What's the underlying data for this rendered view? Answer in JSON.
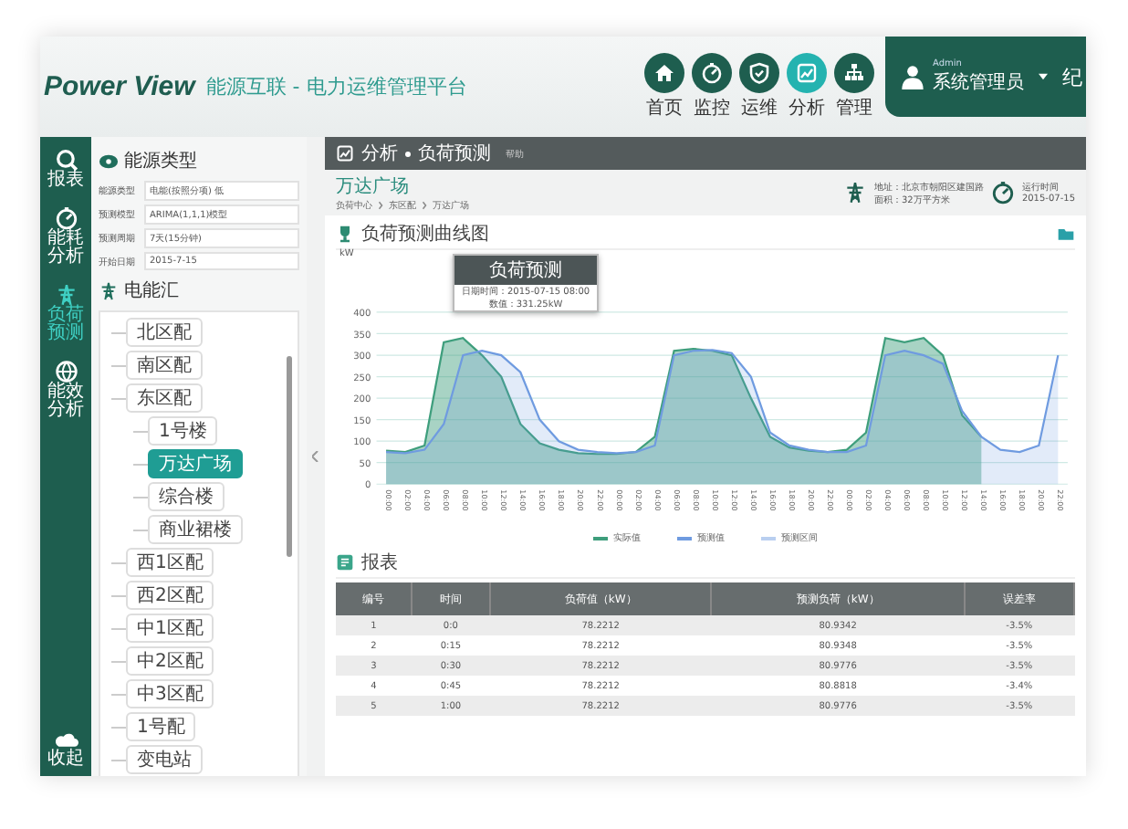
{
  "header": {
    "logo": "Power View",
    "title": "能源互联 - 电力运维管理平台",
    "nav": [
      {
        "label": "首页",
        "selected": false
      },
      {
        "label": "监控",
        "selected": false
      },
      {
        "label": "运维",
        "selected": false
      },
      {
        "label": "分析",
        "selected": true
      },
      {
        "label": "管理",
        "selected": false
      }
    ],
    "user": {
      "role": "Admin",
      "name": "系统管理员",
      "extra": "纪"
    }
  },
  "rail": [
    {
      "label": "报表",
      "selected": false
    },
    {
      "label": "能耗分析",
      "selected": false
    },
    {
      "label": "负荷预测",
      "selected": true
    },
    {
      "label": "能效分析",
      "selected": false
    }
  ],
  "rail_footer": {
    "label": "收起"
  },
  "sidebar": {
    "filter_title": "能源类型",
    "fields": [
      {
        "label": "能源类型",
        "value": "电能(按照分项) 低"
      },
      {
        "label": "预测模型",
        "value": "ARIMA(1,1,1)模型"
      },
      {
        "label": "预测周期",
        "value": "7天(15分钟)"
      },
      {
        "label": "开始日期",
        "value": "2015-7-15"
      }
    ],
    "tree_title": "电能汇",
    "tree": [
      {
        "label": "北区配",
        "selected": false
      },
      {
        "label": "南区配",
        "selected": false
      },
      {
        "label": "东区配",
        "selected": false,
        "children": [
          {
            "label": "1号楼",
            "selected": false
          },
          {
            "label": "万达广场",
            "selected": true
          },
          {
            "label": "综合楼",
            "selected": false
          },
          {
            "label": "商业裙楼",
            "selected": false
          }
        ]
      },
      {
        "label": "西1区配",
        "selected": false
      },
      {
        "label": "西2区配",
        "selected": false
      },
      {
        "label": "中1区配",
        "selected": false
      },
      {
        "label": "中2区配",
        "selected": false
      },
      {
        "label": "中3区配",
        "selected": false
      },
      {
        "label": "1号配",
        "selected": false
      },
      {
        "label": "变电站",
        "selected": false
      }
    ]
  },
  "breadcrumb": {
    "items": [
      "分析",
      "负荷预测"
    ],
    "note": "帮助"
  },
  "site": {
    "name": "万达广场",
    "path": [
      "负荷中心",
      "东区配",
      "万达广场"
    ],
    "info": [
      {
        "label": "地址：",
        "value": "北京市朝阳区建国路"
      },
      {
        "label": "面积：",
        "value": "32万平方米"
      }
    ],
    "clock": {
      "label": "运行时间",
      "value": "2015-07-15"
    }
  },
  "chart_panel": {
    "title": "负荷预测曲线图",
    "unit": "kW",
    "band_label": "预测区间",
    "tooltip": {
      "title": "负荷预测",
      "lines": [
        "日期时间：2015-07-15 08:00",
        "数值：331.25kW"
      ]
    },
    "chart_data": {
      "type": "area",
      "categories": [
        "00:00",
        "02:00",
        "04:00",
        "06:00",
        "08:00",
        "10:00",
        "12:00",
        "14:00",
        "16:00",
        "18:00",
        "20:00",
        "22:00",
        "00:00",
        "02:00",
        "04:00",
        "06:00",
        "08:00",
        "10:00",
        "12:00",
        "14:00",
        "16:00",
        "18:00",
        "20:00",
        "22:00",
        "00:00",
        "02:00",
        "04:00",
        "06:00",
        "08:00",
        "10:00",
        "12:00",
        "14:00",
        "16:00",
        "18:00",
        "20:00",
        "22:00"
      ],
      "series": [
        {
          "name": "实际值",
          "color": "#3e9e7c",
          "values": [
            78,
            75,
            90,
            330,
            340,
            300,
            250,
            140,
            95,
            80,
            72,
            70,
            70,
            75,
            110,
            310,
            315,
            310,
            300,
            200,
            110,
            85,
            78,
            75,
            80,
            120,
            340,
            330,
            340,
            300,
            160,
            110,
            null,
            null,
            null,
            null
          ]
        },
        {
          "name": "预测值",
          "color": "#6f9be0",
          "values": [
            75,
            72,
            80,
            140,
            300,
            310,
            300,
            260,
            150,
            100,
            80,
            75,
            72,
            75,
            90,
            300,
            310,
            312,
            305,
            250,
            120,
            90,
            80,
            75,
            75,
            90,
            300,
            310,
            300,
            280,
            170,
            110,
            80,
            75,
            90,
            300
          ]
        }
      ],
      "ylim": [
        0,
        400
      ],
      "yticks": [
        0,
        50,
        100,
        150,
        200,
        250,
        300,
        350,
        400
      ],
      "grid": true
    }
  },
  "report": {
    "title": "报表",
    "columns": [
      "编号",
      "时间",
      "负荷值（kW）",
      "预测负荷（kW）",
      "误差率"
    ],
    "rows": [
      [
        "1",
        "0:0",
        "78.2212",
        "80.9342",
        "-3.5%"
      ],
      [
        "2",
        "0:15",
        "78.2212",
        "80.9348",
        "-3.5%"
      ],
      [
        "3",
        "0:30",
        "78.2212",
        "80.9776",
        "-3.5%"
      ],
      [
        "4",
        "0:45",
        "78.2212",
        "80.8818",
        "-3.4%"
      ],
      [
        "5",
        "1:00",
        "78.2212",
        "80.9776",
        "-3.5%"
      ]
    ]
  }
}
